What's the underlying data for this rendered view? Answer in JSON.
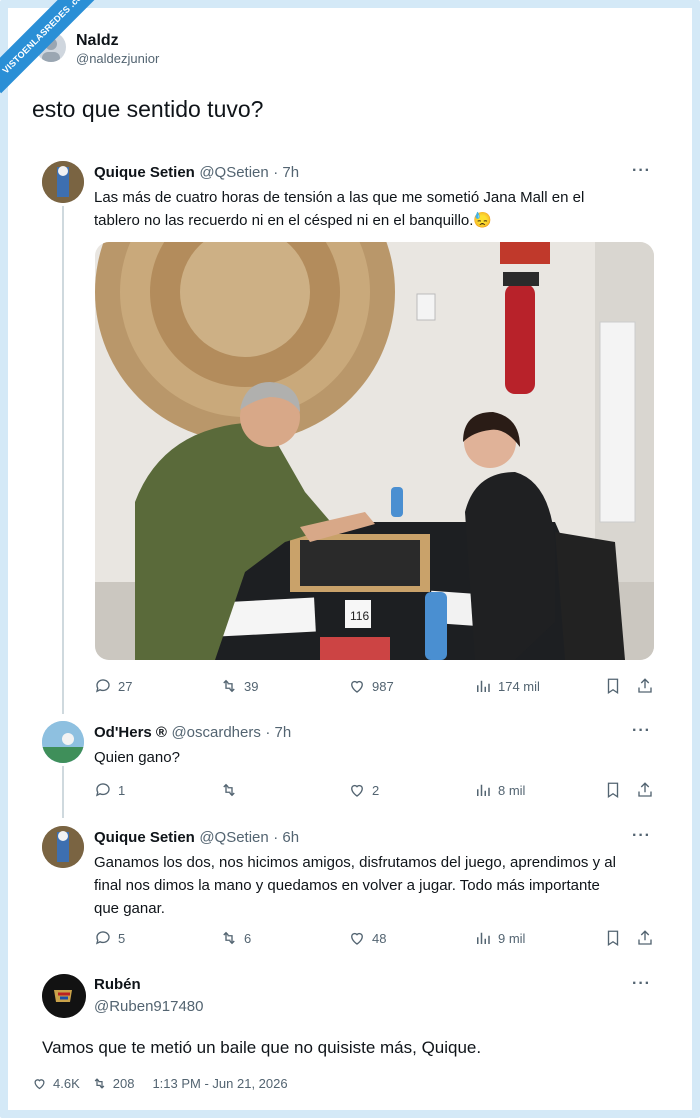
{
  "watermark": "VISTOENLASREDES .com",
  "poster": {
    "name": "Naldz",
    "handle": "@naldezjunior",
    "text": "esto que sentido tuvo?"
  },
  "tweets": [
    {
      "name": "Quique Setien",
      "handle": "@QSetien",
      "time": "· 7h",
      "lines": [
        "Las más de cuatro horas de tensión a las que me sometió Jana Mall en el",
        "tablero no las recuerdo ni en el césped  ni en el banquillo.😓"
      ],
      "photo_numbers": [
        "116"
      ],
      "stats": {
        "replies": "27",
        "retweets": "39",
        "likes": "987",
        "views": "174 mil"
      }
    },
    {
      "name": "Od'Hers ®",
      "handle": "@oscardhers",
      "time": "· 7h",
      "lines": [
        "Quien gano?"
      ],
      "stats": {
        "replies": "1",
        "retweets": "",
        "likes": "2",
        "views": "8 mil"
      }
    },
    {
      "name": "Quique Setien",
      "handle": "@QSetien",
      "time": "· 6h",
      "lines": [
        "Ganamos los dos, nos hicimos amigos, disfrutamos del juego, aprendimos y al",
        "final nos dimos la mano y quedamos en volver a jugar. Todo más importante",
        "que ganar."
      ],
      "stats": {
        "replies": "5",
        "retweets": "6",
        "likes": "48",
        "views": "9 mil"
      }
    }
  ],
  "reply": {
    "name": "Rubén",
    "handle": "@Ruben917480",
    "text": "Vamos que te metió un baile que no quisiste más, Quique."
  },
  "footer": {
    "likes": "4.6K",
    "retweets": "208",
    "timestamp": "1:13 PM - Jun 21, 2026"
  },
  "colors": {
    "accent": "#2a8fd6",
    "frame": "#d4e9f7",
    "muted": "#536471"
  }
}
